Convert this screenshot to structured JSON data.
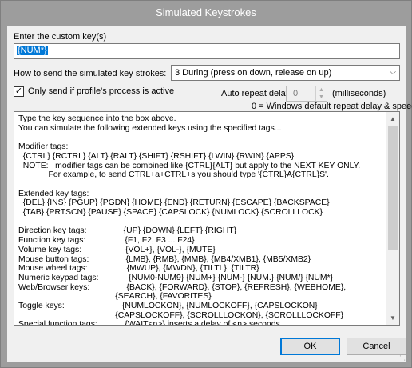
{
  "window": {
    "title": "Simulated Keystrokes"
  },
  "custom_key": {
    "label": "Enter the custom key(s)",
    "value": "{NUM*}"
  },
  "send_mode": {
    "label": "How to send the simulated key strokes:",
    "selected": "3 During (press on down, release on up)",
    "chevron_icon": "chevron-down-icon"
  },
  "only_active": {
    "label": "Only send if profile's process is active",
    "checked": "✓"
  },
  "auto_repeat": {
    "label": "Auto repeat delay",
    "value": "0",
    "unit": "(milliseconds)",
    "note": "0 = Windows default repeat delay & speed."
  },
  "help_text": "Type the key sequence into the box above.\nYou can simulate the following extended keys using the specified tags...\n\nModifier tags:\n  {CTRL} {RCTRL} {ALT} {RALT} {SHIFT} {RSHIFT} {LWIN} {RWIN} {APPS}\n  NOTE:   modifier tags can be combined like {CTRL}{ALT} but apply to the NEXT KEY ONLY.\n             For example, to send CTRL+a+CTRL+s you should type '{CTRL}A{CTRL}S'.\n\nExtended key tags:\n  {DEL} {INS} {PGUP} {PGDN} {HOME} {END} {RETURN} {ESCAPE} {BACKSPACE}\n  {TAB} {PRTSCN} {PAUSE} {SPACE} {CAPSLOCK} {NUMLOCK} {SCROLLLOCK}\n\nDirection key tags:                {UP} {DOWN} {LEFT} {RIGHT}\nFunction key tags:                 {F1, F2, F3 ... F24}\nVolume key tags:                   {VOL+}, {VOL-}, {MUTE}\nMouse button tags:                {LMB}, {RMB}, {MMB}, {MB4/XMB1}, {MB5/XMB2}\nMouse wheel tags:                 {MWUP}, {MWDN}, {TILTL}, {TILTR}\nNumeric keypad tags:             {NUM0-NUM9} {NUM+} {NUM-} {NUM.} {NUM/} {NUM*}\nWeb/Browser keys:                {BACK}, {FORWARD}, {STOP}, {REFRESH}, {WEBHOME},\n                                          {SEARCH}, {FAVORITES}\nToggle keys:                         {NUMLOCKON}, {NUMLOCKOFF}, {CAPSLOCKON}\n                                          {CAPSLOCKOFF}, {SCROLLLOCKON}, {SCROLLLOCKOFF}\nSpecial function tags:            {WAIT<n>} inserts a delay of <n> seconds.",
  "buttons": {
    "ok": "OK",
    "cancel": "Cancel"
  },
  "icons": {
    "scroll_up": "scroll-up-icon",
    "scroll_down": "scroll-down-icon",
    "resize": "resize-grip-icon"
  }
}
